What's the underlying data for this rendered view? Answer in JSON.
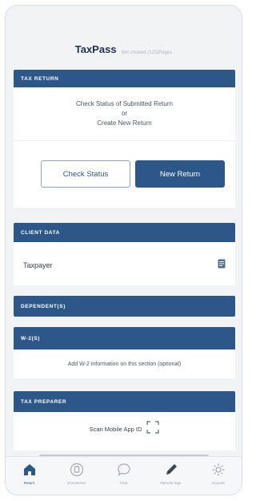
{
  "app": {
    "title": "TaxPass",
    "subtitle": "Not created (123)Pages"
  },
  "tax_return": {
    "header": "TAX RETURN",
    "line1": "Check Status of Submitted Return",
    "line2": "or",
    "line3": "Create New Return",
    "check_status_label": "Check Status",
    "new_return_label": "New Return"
  },
  "client_data": {
    "header": "CLIENT DATA",
    "row_label": "Taxpayer",
    "row_icon": "document-icon"
  },
  "dependents": {
    "header": "DEPENDENT(S)"
  },
  "w2": {
    "header": "W-2(S)",
    "body": "Add W-2 information on this section (optional)"
  },
  "tax_preparer": {
    "header": "TAX PREPARER",
    "scan_label": "Scan Mobile App ID"
  },
  "tabs": [
    {
      "label": "Return",
      "icon": "home-icon",
      "active": true
    },
    {
      "label": "Documents",
      "icon": "document-icon",
      "active": false
    },
    {
      "label": "Chat",
      "icon": "chat-icon",
      "active": false
    },
    {
      "label": "Remote Sign",
      "icon": "pen-icon",
      "active": false
    },
    {
      "label": "Account",
      "icon": "gear-icon",
      "active": false
    }
  ],
  "colors": {
    "primary": "#2d5788",
    "background": "#f2f3f5",
    "card": "#ffffff"
  }
}
